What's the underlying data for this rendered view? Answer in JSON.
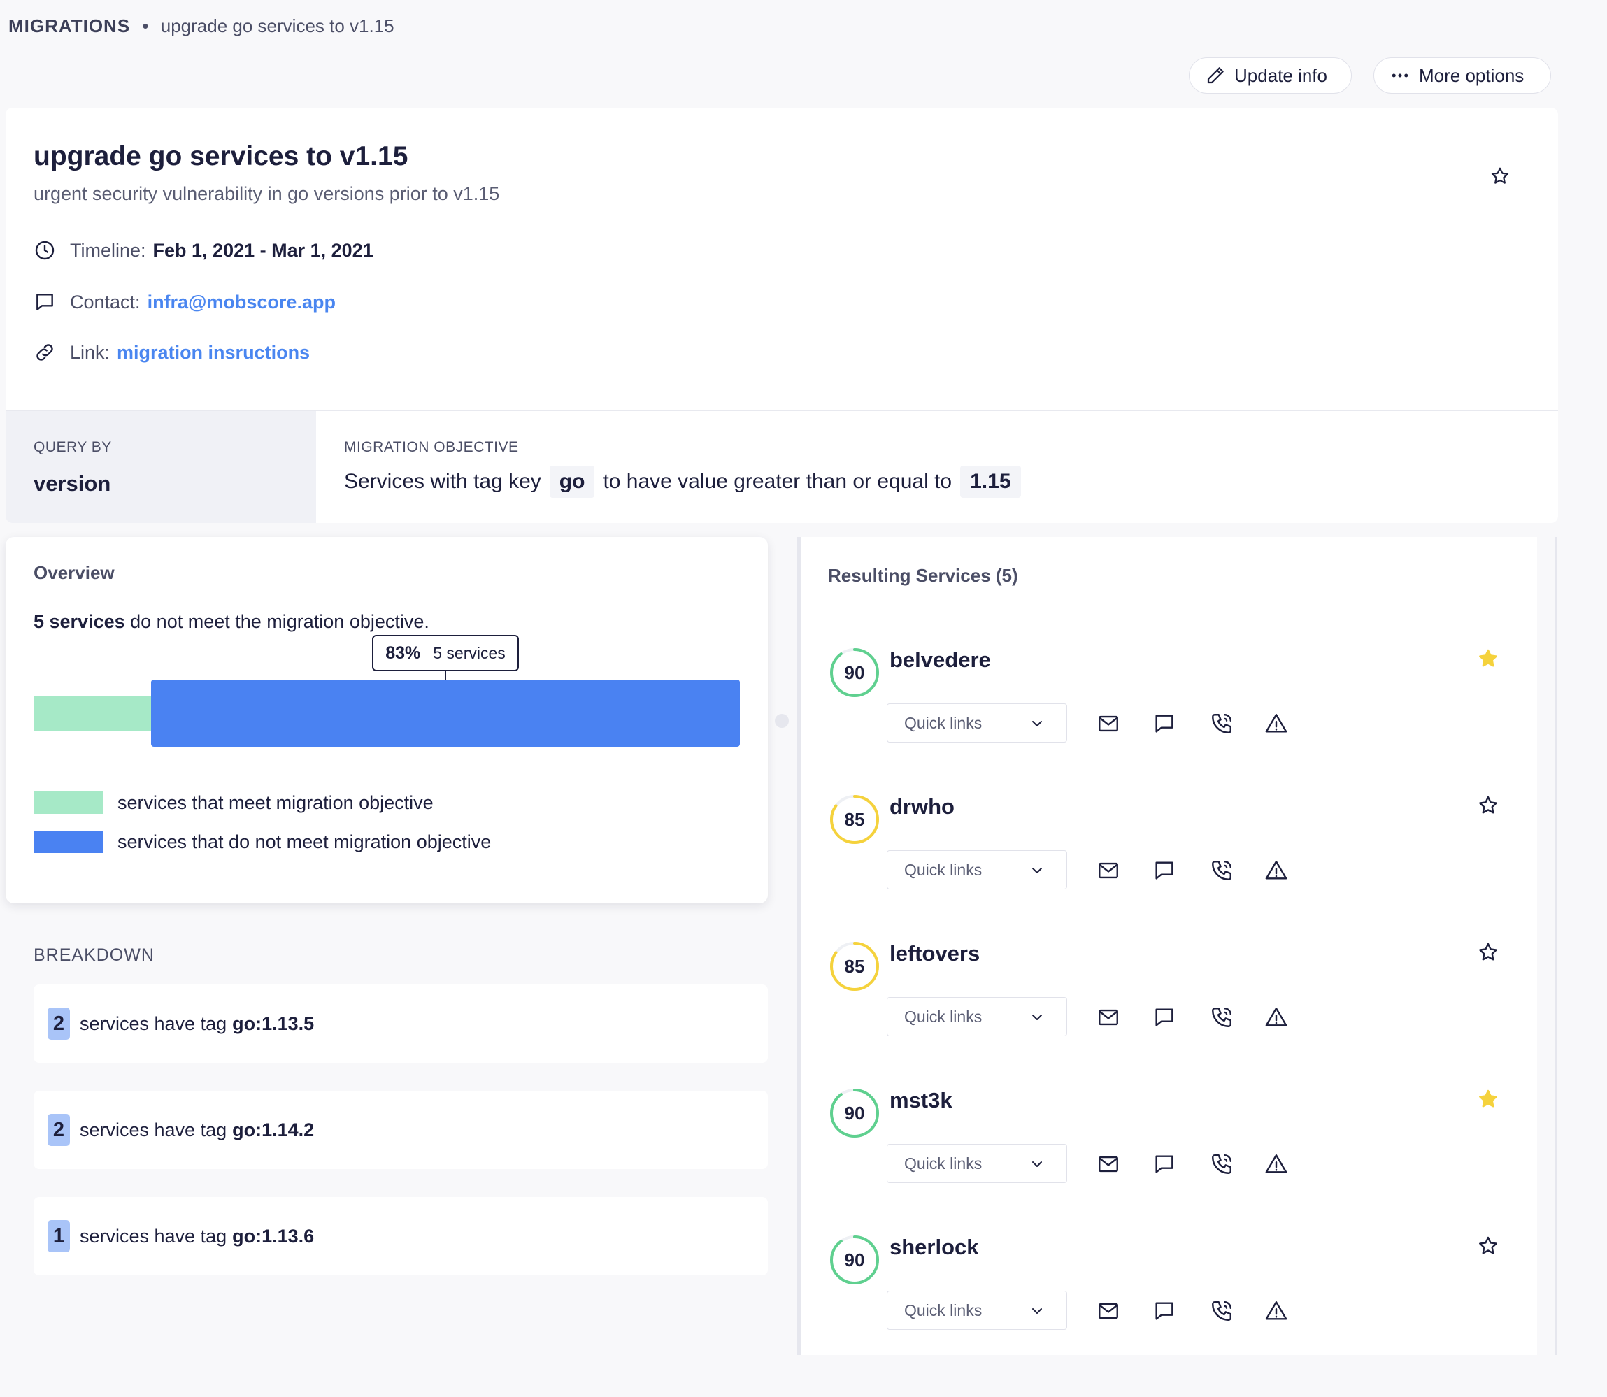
{
  "breadcrumb": {
    "root": "MIGRATIONS",
    "separator": "•",
    "current": "upgrade go services to v1.15"
  },
  "header_actions": {
    "update_label": "Update info",
    "more_label": "More options"
  },
  "migration": {
    "title": "upgrade go services to v1.15",
    "subtitle": "urgent security vulnerability in go versions prior to v1.15",
    "timeline_label": "Timeline:",
    "timeline_value": "Feb 1, 2021 - Mar 1, 2021",
    "contact_label": "Contact:",
    "contact_value": "infra@mobscore.app",
    "link_label": "Link:",
    "link_value": "migration insructions"
  },
  "query": {
    "caption": "QUERY BY",
    "value": "version"
  },
  "objective": {
    "caption": "MIGRATION OBJECTIVE",
    "text_before": "Services with tag key",
    "tag_key": "go",
    "text_middle": "to have value greater than or equal to",
    "tag_value": "1.15"
  },
  "overview": {
    "title": "Overview",
    "summary_bold": "5 services",
    "summary_rest": "do not meet the migration objective.",
    "tooltip_percent": "83%",
    "tooltip_count": "5 services",
    "meet_fraction": 0.17,
    "not_meet_fraction": 0.83,
    "legend_meet": "services that meet migration objective",
    "legend_not_meet": "services that do not meet migration objective",
    "colors": {
      "meet": "#a6e9c7",
      "not_meet": "#4a82f2"
    }
  },
  "breakdown": {
    "title": "BREAKDOWN",
    "rows": [
      {
        "count": "2",
        "text": "services have tag",
        "tag": "go:1.13.5"
      },
      {
        "count": "2",
        "text": "services have tag",
        "tag": "go:1.14.2"
      },
      {
        "count": "1",
        "text": "services have tag",
        "tag": "go:1.13.6"
      }
    ]
  },
  "results": {
    "title": "Resulting Services (5)",
    "quick_links_label": "Quick links",
    "services": [
      {
        "name": "belvedere",
        "score": "90",
        "score_color": "#5fd08f",
        "starred": true
      },
      {
        "name": "drwho",
        "score": "85",
        "score_color": "#f5d23c",
        "starred": false
      },
      {
        "name": "leftovers",
        "score": "85",
        "score_color": "#f5d23c",
        "starred": false
      },
      {
        "name": "mst3k",
        "score": "90",
        "score_color": "#5fd08f",
        "starred": true
      },
      {
        "name": "sherlock",
        "score": "90",
        "score_color": "#5fd08f",
        "starred": false
      }
    ]
  }
}
